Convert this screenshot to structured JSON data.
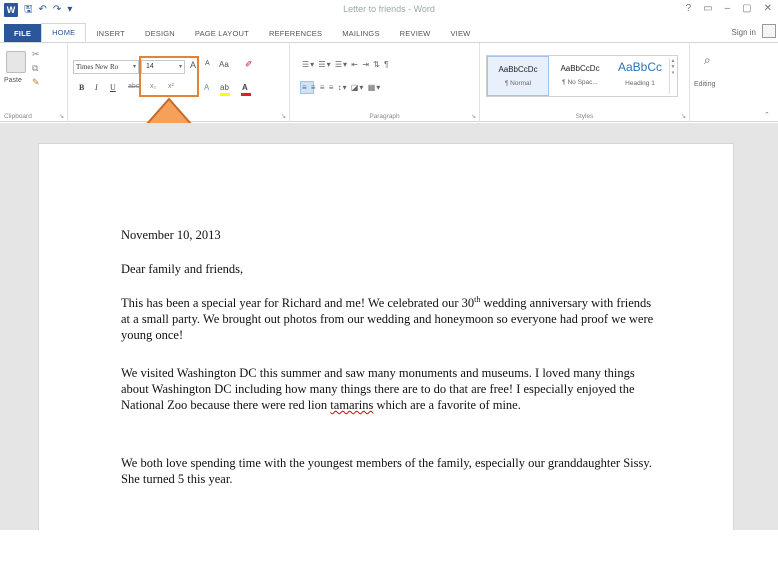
{
  "window": {
    "title": "Letter to friends - Word",
    "app_icon": "W",
    "controls": [
      "?",
      "▭",
      "–",
      "▢",
      "✕"
    ]
  },
  "quick_access": [
    "save-icon",
    "undo-icon",
    "redo-icon"
  ],
  "tabs": [
    {
      "label": "FILE"
    },
    {
      "label": "HOME"
    },
    {
      "label": "INSERT"
    },
    {
      "label": "DESIGN"
    },
    {
      "label": "PAGE LAYOUT"
    },
    {
      "label": "REFERENCES"
    },
    {
      "label": "MAILINGS"
    },
    {
      "label": "REVIEW"
    },
    {
      "label": "VIEW"
    }
  ],
  "signin": "Sign in",
  "ribbon": {
    "clipboard": {
      "paste": "Paste",
      "label": "Clipboard"
    },
    "font": {
      "name": "Times New Ro",
      "size": "14",
      "grow": "A",
      "shrink": "A",
      "case": "Aa",
      "bold": "B",
      "italic": "I",
      "underline": "U",
      "strike": "abc",
      "sub": "x₂",
      "sup": "x²",
      "effects": "A",
      "highlight": "ab",
      "color": "A"
    },
    "paragraph": {
      "label": "Paragraph"
    },
    "styles": {
      "label": "Styles",
      "items": [
        {
          "preview": "AaBbCcDc",
          "name": "¶ Normal"
        },
        {
          "preview": "AaBbCcDc",
          "name": "¶ No Spac..."
        },
        {
          "preview": "AaBbCc",
          "name": "Heading 1"
        }
      ]
    },
    "editing": {
      "label": "Editing"
    }
  },
  "document": {
    "date": "November 10, 2013",
    "greeting": "Dear family and friends,",
    "paragraph1": "This has been a special year for Richard and me! We celebrated our 30th wedding anniversary with friends at a small party.  We brought out photos from our wedding and honeymoon so everyone had proof we were young once!",
    "paragraph2_before": "We visited Washington DC this summer and saw many monuments and museums.  I loved many things about Washington DC including how many things there are to do that are free!  I especially enjoyed the National Zoo because there were red lion ",
    "paragraph2_misspelled": "tamarins",
    "paragraph2_after": " which are a favorite of mine.",
    "paragraph3": "We both love spending time with the youngest members of the family, especially our granddaughter Sissy.  She turned 5 this year."
  },
  "colors": {
    "accent": "#2b579a",
    "annotation": "#e0843a"
  }
}
